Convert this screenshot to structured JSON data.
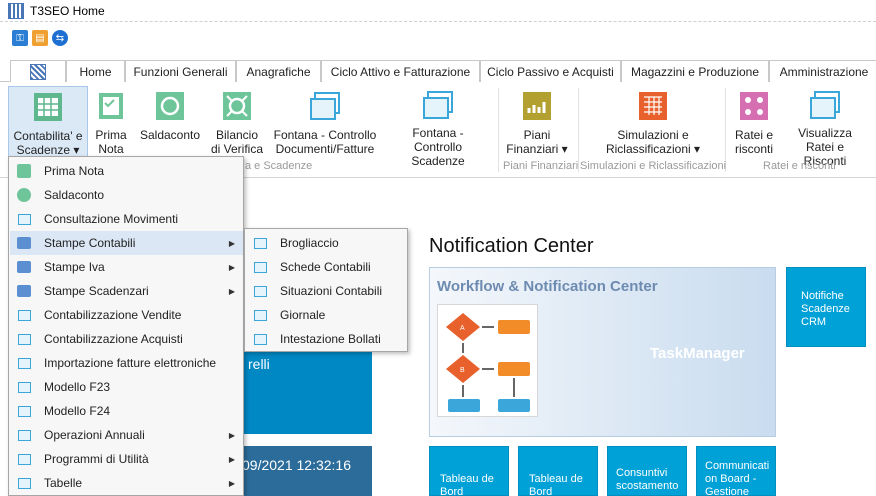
{
  "window": {
    "title": "T3SEO Home"
  },
  "tabs": [
    "Home",
    "Funzioni Generali",
    "Anagrafiche",
    "Ciclo Attivo e Fatturazione",
    "Ciclo Passivo e Acquisti",
    "Magazzini e Produzione",
    "Amministrazione"
  ],
  "active_tab": "Amministrazione",
  "ribbon": {
    "buttons": [
      {
        "line1": "Contabilita' e",
        "line2": "Scadenze ▾"
      },
      {
        "line1": "Prima",
        "line2": "Nota"
      },
      {
        "line1": "Saldaconto",
        "line2": ""
      },
      {
        "line1": "Bilancio",
        "line2": "di Verifica"
      },
      {
        "line1": "Fontana - Controllo",
        "line2": "Documenti/Fatture"
      },
      {
        "line1": "Fontana -",
        "line2": "Controllo Scadenze"
      },
      {
        "line1": "Piani",
        "line2": "Finanziari ▾"
      },
      {
        "line1": "Simulazioni e",
        "line2": "Riclassificazioni ▾"
      },
      {
        "line1": "Ratei e",
        "line2": "risconti"
      },
      {
        "line1": "Visualizza",
        "line2": "Ratei e Risconti"
      }
    ],
    "groups": [
      "a e Scadenze",
      "Piani Finanziari",
      "Simulazioni e Riclassificazioni",
      "Ratei e risconti"
    ]
  },
  "main_menu": {
    "items": [
      {
        "label": "Prima Nota",
        "icon": "prima-nota-icon",
        "submenu": false
      },
      {
        "label": "Saldaconto",
        "icon": "saldaconto-icon",
        "submenu": false
      },
      {
        "label": "Consultazione Movimenti",
        "icon": "document-icon",
        "submenu": false
      },
      {
        "label": "Stampe Contabili",
        "icon": "printer-icon",
        "submenu": true
      },
      {
        "label": "Stampe Iva",
        "icon": "printer-icon",
        "submenu": true
      },
      {
        "label": "Stampe Scadenzari",
        "icon": "printer-icon",
        "submenu": true
      },
      {
        "label": "Contabilizzazione Vendite",
        "icon": "document-icon",
        "submenu": false
      },
      {
        "label": "Contabilizzazione Acquisti",
        "icon": "document-icon",
        "submenu": false
      },
      {
        "label": "Importazione fatture elettroniche",
        "icon": "document-icon",
        "submenu": false
      },
      {
        "label": "Modello F23",
        "icon": "document-icon",
        "submenu": false
      },
      {
        "label": "Modello F24",
        "icon": "document-icon",
        "submenu": false
      },
      {
        "label": "Operazioni Annuali",
        "icon": "document-icon",
        "submenu": true
      },
      {
        "label": "Programmi di Utilità",
        "icon": "document-icon",
        "submenu": true
      },
      {
        "label": "Tabelle",
        "icon": "document-icon",
        "submenu": true
      }
    ]
  },
  "sub_menu": {
    "items": [
      "Brogliaccio",
      "Schede Contabili",
      "Situazioni Contabili",
      "Giornale",
      "Intestazione Bollati"
    ]
  },
  "notification_center": {
    "title": "Notification Center",
    "workflow_title": "Workflow & Notification Center",
    "task_manager": "TaskManager",
    "tiles": [
      {
        "lines": [
          "Notifiche",
          "Scadenze",
          "CRM"
        ]
      },
      {
        "lines": [
          "Tableau de",
          "Bord"
        ]
      },
      {
        "lines": [
          "Tableau de",
          "Bord"
        ]
      },
      {
        "lines": [
          "Consuntivi",
          "scostamento"
        ]
      },
      {
        "lines": [
          "Communicati",
          "on Board -",
          "Gestione"
        ]
      }
    ]
  },
  "left_tiles": {
    "name_fragment": "relli",
    "datetime_fragment": "09/2021 12:32:16"
  },
  "colors": {
    "accent": "#00a1d6",
    "menu_highlight": "#dbe7f4",
    "ribbon_pressed": "#dbe9f7"
  }
}
